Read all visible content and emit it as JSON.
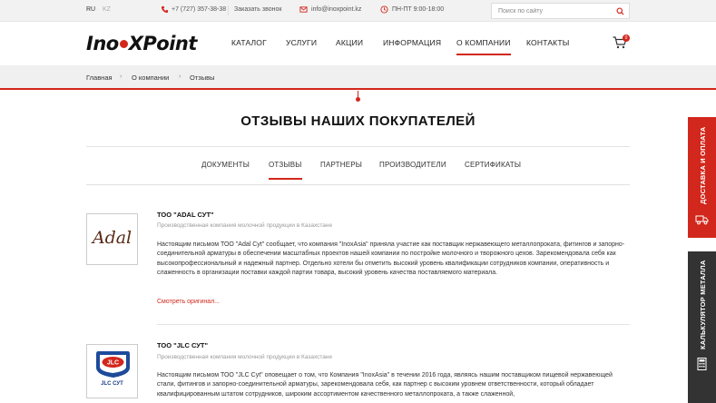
{
  "topbar": {
    "lang_ru": "RU",
    "lang_sep": "·",
    "lang_kz": "KZ",
    "phone": "+7 (727) 357-38-38",
    "callback": "Заказать звонок",
    "email": "info@inoxpoint.kz",
    "hours": "ПН-ПТ  9:00-18:00",
    "search_placeholder": "Поиск по сайту"
  },
  "logo": {
    "part1": "Ino",
    "part2": "XPoint"
  },
  "nav": {
    "catalog": "КАТАЛОГ",
    "services": "УСЛУГИ",
    "promo": "АКЦИИ",
    "info": "ИНФОРМАЦИЯ",
    "about": "О КОМПАНИИ",
    "contacts": "КОНТАКТЫ",
    "cart_count": "0"
  },
  "breadcrumb": {
    "home": "Главная",
    "about": "О компании",
    "current": "Отзывы"
  },
  "page_title": "ОТЗЫВЫ НАШИХ ПОКУПАТЕЛЕЙ",
  "tabs": {
    "documents": "ДОКУМЕНТЫ",
    "reviews": "ОТЗЫВЫ",
    "partners": "ПАРТНЕРЫ",
    "manufacturers": "ПРОИЗВОДИТЕЛИ",
    "certificates": "СЕРТИФИКАТЫ"
  },
  "reviews": [
    {
      "logo_text": "Adal",
      "name": "ТОО \"ADAL СУТ\"",
      "subtitle": "Производственная компания молочной продукции в Казахстане",
      "text": "Настоящим письмом ТОО \"Adal Cyt\" сообщает, что компания \"InoxAsia\" приняла участие как поставщик нержавеющего металлопроката, фитингов и запорно-соединительной арматуры в обеспечении масштабных проектов нашей компании по постройке молочного и творожного цехов. Зарекомендовала себя как высокопрофессиональный и надежный партнер. Отдельно хотели бы отметить высокий уровень квалификации сотрудников компании, оперативность и слаженность в организации поставки каждой партии товара, высокий уровень качества поставляемого материала.",
      "link": "Смотреть оригинал..."
    },
    {
      "logo_text": "JLC",
      "logo_caption": "JLC СУТ",
      "name": "ТОО \"JLC СУТ\"",
      "subtitle": "Производственная компания молочной продукции в Казахстане",
      "text": "Настоящим письмом ТОО \"JLC Cyt\" оповещает о том, что Компания \"InoxAsia\" в течении 2016 года, являясь нашим поставщиком пищевой нержавеющей стали, фитингов и запорно-соединительной арматуры, зарекомендовала себя, как партнер с высоким уровнем ответственности, который обладает квалифицированным штатом сотрудников, широким ассортиментом качественного металлопроката, а также слаженной,"
    }
  ],
  "side": {
    "delivery": "ДОСТАВКА И ОПЛАТА",
    "calculator": "КАЛЬКУЛЯТОР МЕТАЛЛА"
  },
  "colors": {
    "accent": "#d2271c",
    "dark_panel": "#333333"
  }
}
